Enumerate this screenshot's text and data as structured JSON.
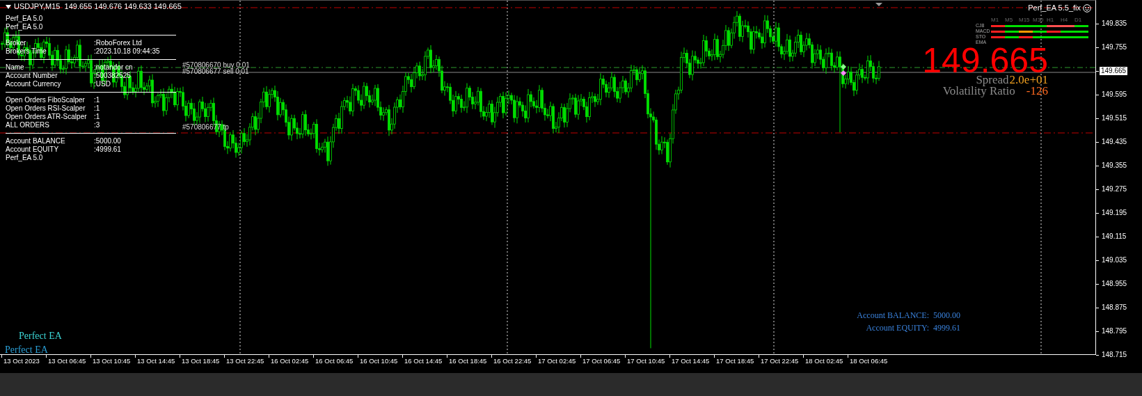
{
  "symbol_header": {
    "text": "USDJPY,M15  149.655 149.676 149.633 149.665"
  },
  "info_panel": {
    "sections": [
      [
        {
          "label": "Perf_EA 5.0"
        },
        {
          "label": "Perf_EA 5.0"
        }
      ],
      [
        {
          "label": "Broker",
          "value": ":RoboForex Ltd"
        },
        {
          "label": "Brokers Time",
          "value": ":2023.10.18 09:44:35"
        }
      ],
      [
        {
          "label": "Name",
          "value": ":notandor cn"
        },
        {
          "label": "Account Number",
          "value": ":500382525"
        },
        {
          "label": "Account Currency",
          "value": ":USD"
        }
      ],
      [
        {
          "label": "Open Orders FiboScalper",
          "value": ":1"
        },
        {
          "label": "Open Orders RSI-Scalper",
          "value": ":1"
        },
        {
          "label": "Open Orders ATR-Scalper",
          "value": ":1"
        },
        {
          "label": "ALL ORDERS",
          "value": ":3"
        }
      ],
      [
        {
          "label": "Account BALANCE",
          "value": ":5000.00"
        },
        {
          "label": "Account EQUITY",
          "value": ":4999.61"
        },
        {
          "label": "Perf_EA 5.0"
        }
      ]
    ]
  },
  "order_labels": [
    "#570806670 buy 0.01",
    "#570806677 sell 0.01",
    "#570806677 tp"
  ],
  "indicator": {
    "title": "Perf_EA 5.5_fix",
    "timeframes": [
      "M1",
      "M5",
      "M15",
      "M30",
      "H1",
      "H4",
      "D1"
    ],
    "rows": [
      {
        "label": "CJ8",
        "signals": [
          {
            "color": "#ff2020"
          },
          {
            "color": "#00e000"
          },
          {
            "color": "#00e000"
          },
          {
            "color": "#00e000"
          },
          {
            "color": "#ff5050"
          },
          {
            "color": "#ff5050"
          },
          {
            "color": "#00e000"
          }
        ]
      },
      {
        "label": "MACD",
        "signals": [
          {
            "color": "#ff2020"
          },
          {
            "color": "#00e000"
          },
          {
            "color": "#ff9900"
          },
          {
            "color": "#00e000"
          },
          {
            "color": "#ff2020"
          },
          {
            "color": "#00e000"
          },
          {
            "color": "#00e000"
          }
        ]
      },
      {
        "label": "STO",
        "signals": [
          {
            "color": "#ff2020"
          },
          {
            "color": "#00e000"
          },
          {
            "color": "#ff2020"
          },
          {
            "color": "#00e000"
          },
          {
            "color": "#00e000"
          },
          {
            "color": "#00e000"
          },
          {
            "color": "#00e000"
          }
        ]
      },
      {
        "label": "EMA"
      }
    ]
  },
  "price_display": {
    "price": "149.665",
    "spread_label": "Spread",
    "spread_value": "2.0e+01",
    "volatility_label": "Volatility Ratio",
    "volatility_value": "-126"
  },
  "footer_labels": [
    {
      "text": "Perfect EA",
      "color": "#3cd7d7"
    },
    {
      "text": "Perfect EA",
      "color": "#2a9fd6"
    }
  ],
  "account_summary": [
    {
      "label": "Account BALANCE:",
      "value": "5000.00"
    },
    {
      "label": "Account EQUITY:",
      "value": "4999.61"
    }
  ],
  "price_axis": [
    {
      "text": "149.835",
      "kind": "tick"
    },
    {
      "text": "149.755",
      "kind": "tick"
    },
    {
      "text": "149.665",
      "kind": "current"
    },
    {
      "text": "149.595",
      "kind": "tick"
    },
    {
      "text": "149.515",
      "kind": "tick"
    },
    {
      "text": "149.435",
      "kind": "tick"
    },
    {
      "text": "149.355",
      "kind": "tick"
    },
    {
      "text": "149.275",
      "kind": "tick"
    },
    {
      "text": "149.195",
      "kind": "tick"
    },
    {
      "text": "149.115",
      "kind": "tick"
    },
    {
      "text": "149.035",
      "kind": "tick"
    },
    {
      "text": "148.955",
      "kind": "tick"
    },
    {
      "text": "148.875",
      "kind": "tick"
    },
    {
      "text": "148.795",
      "kind": "tick"
    },
    {
      "text": "148.715",
      "kind": "tick"
    }
  ],
  "time_axis": [
    "13 Oct 2023",
    "13 Oct 06:45",
    "13 Oct 10:45",
    "13 Oct 14:45",
    "13 Oct 18:45",
    "13 Oct 22:45",
    "16 Oct 02:45",
    "16 Oct 06:45",
    "16 Oct 10:45",
    "16 Oct 14:45",
    "16 Oct 18:45",
    "16 Oct 22:45",
    "17 Oct 02:45",
    "17 Oct 06:45",
    "17 Oct 10:45",
    "17 Oct 14:45",
    "17 Oct 18:45",
    "17 Oct 22:45",
    "18 Oct 02:45",
    "18 Oct 06:45"
  ]
}
